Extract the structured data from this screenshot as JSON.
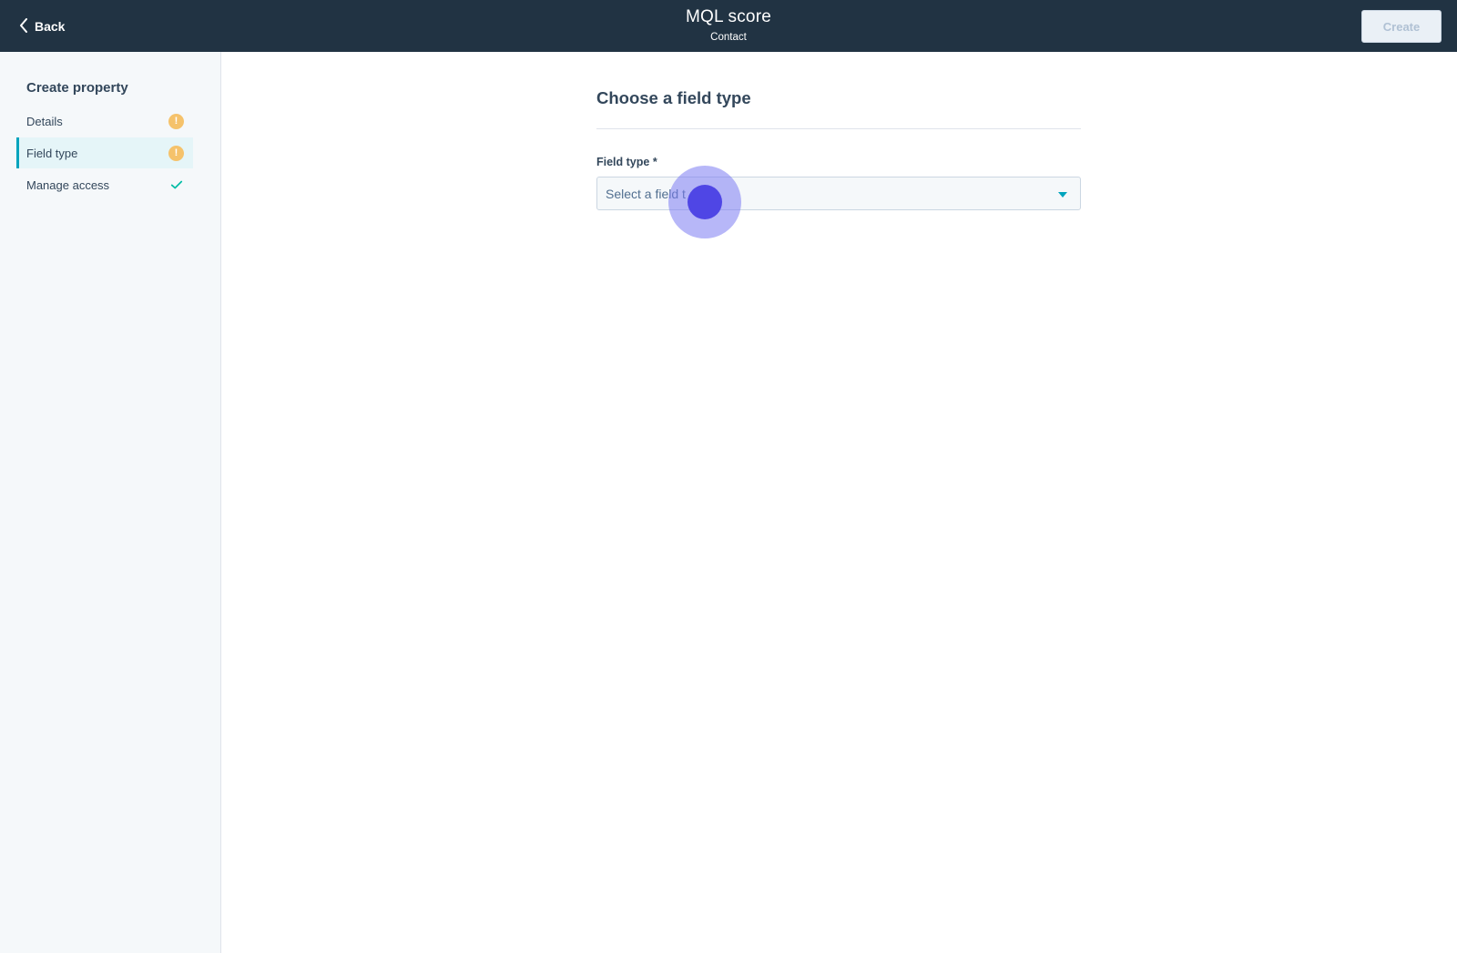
{
  "header": {
    "back_label": "Back",
    "title": "MQL score",
    "subtitle": "Contact",
    "create_label": "Create"
  },
  "sidebar": {
    "heading": "Create property",
    "items": [
      {
        "label": "Details",
        "status_icon": "warning-icon",
        "active": false
      },
      {
        "label": "Field type",
        "status_icon": "warning-icon",
        "active": true
      },
      {
        "label": "Manage access",
        "status_icon": "check-icon",
        "active": false
      }
    ],
    "warning_glyph": "!"
  },
  "main": {
    "heading": "Choose a field type",
    "field_label": "Field type *",
    "select_value": "Select a field t"
  },
  "colors": {
    "header_bg": "#213343",
    "accent": "#00a4bd",
    "warning": "#f5c26b",
    "success": "#00bda5",
    "click_indicator": "#4f46e5"
  }
}
